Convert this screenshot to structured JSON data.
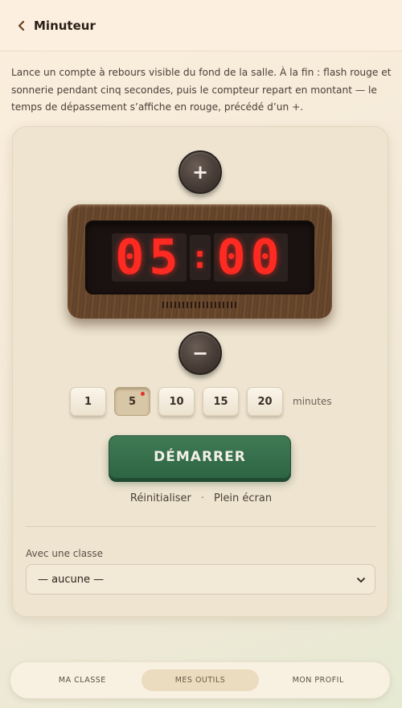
{
  "header": {
    "title": "Minuteur",
    "back_icon": "chevron-left-icon"
  },
  "description": "Lance un compte à rebours visible du fond de la salle. À la fin : flash rouge et sonnerie pendant cinq secondes, puis le compteur repart en montant — le temps de dépassement s’affiche en rouge, précédé d’un +.",
  "timer": {
    "increase_label": "+",
    "decrease_label": "−",
    "minutes": "05",
    "colon": ":",
    "seconds": "00",
    "display_color": "#ff2a22"
  },
  "presets": {
    "options": [
      "1",
      "5",
      "10",
      "15",
      "20"
    ],
    "selected": "5",
    "unit": "minutes"
  },
  "actions": {
    "start_label": "DÉMARRER",
    "reset_label": "Réinitialiser",
    "separator": "·",
    "fullscreen_label": "Plein écran"
  },
  "class_picker": {
    "label": "Avec une classe",
    "value": "— aucune —"
  },
  "nav": {
    "items": [
      {
        "label": "MA CLASSE",
        "active": false
      },
      {
        "label": "MES OUTILS",
        "active": true
      },
      {
        "label": "MON PROFIL",
        "active": false
      }
    ]
  },
  "colors": {
    "accent_green": "#2e6544",
    "background": "#f4ead8"
  }
}
